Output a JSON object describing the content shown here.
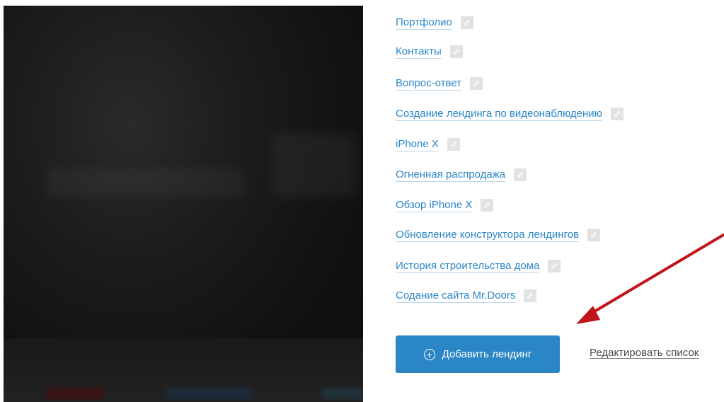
{
  "pages": [
    {
      "label": "Портфолио"
    },
    {
      "label": "Контакты"
    },
    {
      "label": "Вопрос-ответ"
    },
    {
      "label": "Создание лендинга по видеонаблюдению"
    },
    {
      "label": "iPhone X"
    },
    {
      "label": "Огненная распродажа"
    },
    {
      "label": "Обзор iPhone X"
    },
    {
      "label": "Обновление конструктора лендингов"
    },
    {
      "label": "История строительства дома"
    },
    {
      "label": "Содание сайта Mr.Doors"
    }
  ],
  "actions": {
    "add_label": "Добавить лендинг",
    "edit_label": "Редактировать список"
  },
  "colors": {
    "link": "#2d87c8",
    "button": "#2a86c5",
    "arrow": "#c0151b"
  },
  "icons": {
    "copy_link": "link-icon",
    "add": "plus-circle-icon"
  }
}
